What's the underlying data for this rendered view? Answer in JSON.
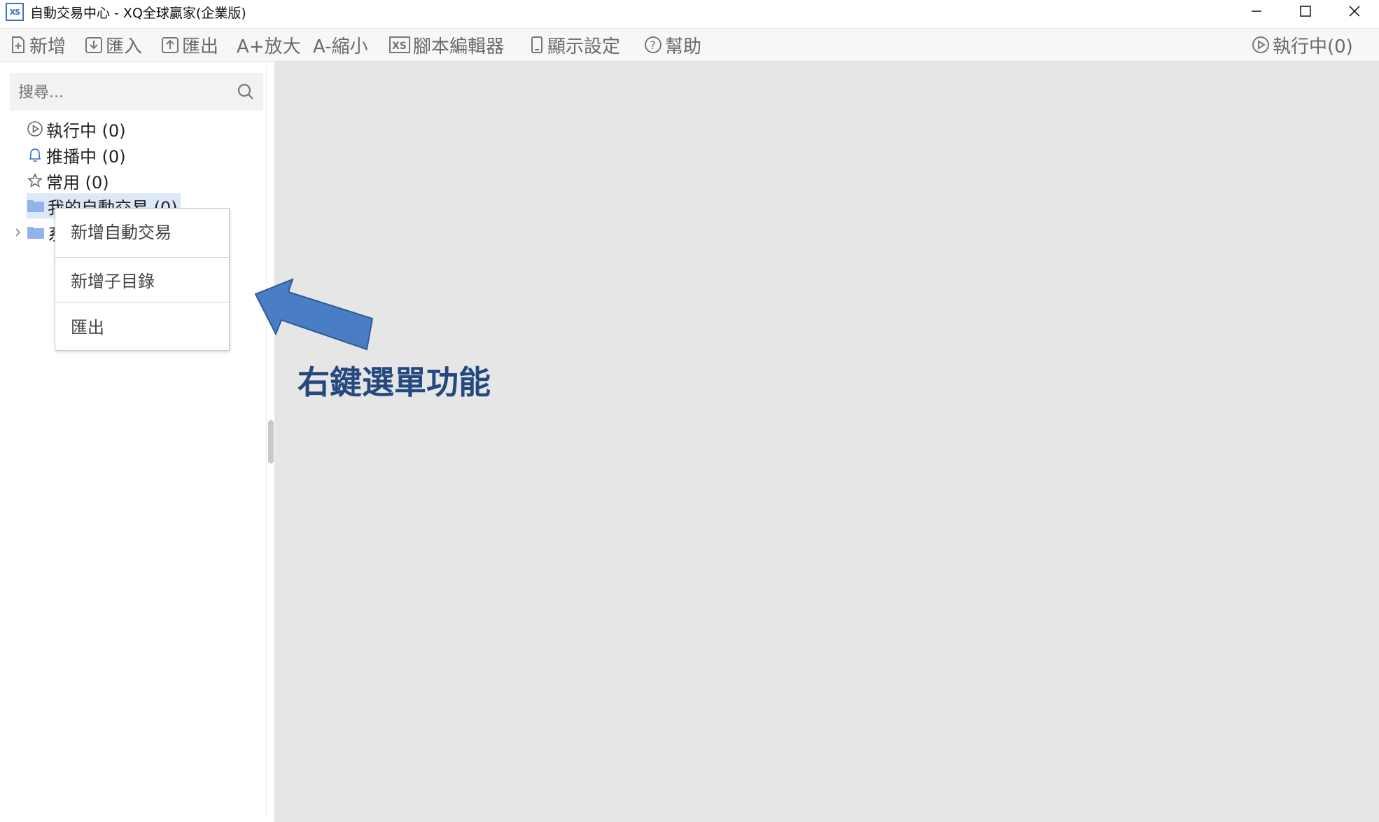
{
  "window": {
    "title": "自動交易中心 - XQ全球贏家(企業版)",
    "logo_text": "XS"
  },
  "toolbar": {
    "new_label": "新增",
    "import_label": "匯入",
    "export_label": "匯出",
    "zoom_in_label": "A+放大",
    "zoom_out_label": "A-縮小",
    "script_editor_label": "腳本編輯器",
    "display_settings_label": "顯示設定",
    "help_label": "幫助",
    "running_label": "執行中(0)"
  },
  "search": {
    "placeholder": "搜尋..."
  },
  "tree": {
    "items": [
      {
        "label": "執行中 (0)"
      },
      {
        "label": "推播中 (0)"
      },
      {
        "label": "常用 (0)"
      },
      {
        "label": "我的自動交易 (0)"
      },
      {
        "label": "系"
      }
    ]
  },
  "context_menu": {
    "items": [
      {
        "label": "新增自動交易"
      },
      {
        "label": "新增子目錄"
      },
      {
        "label": "匯出"
      }
    ]
  },
  "annotation": {
    "text": "右鍵選單功能"
  },
  "colors": {
    "accent": "#3b6fc4",
    "arrow_fill": "#4a7ec4",
    "annotation_text": "#25497f",
    "main_background": "#e6e6e6"
  }
}
